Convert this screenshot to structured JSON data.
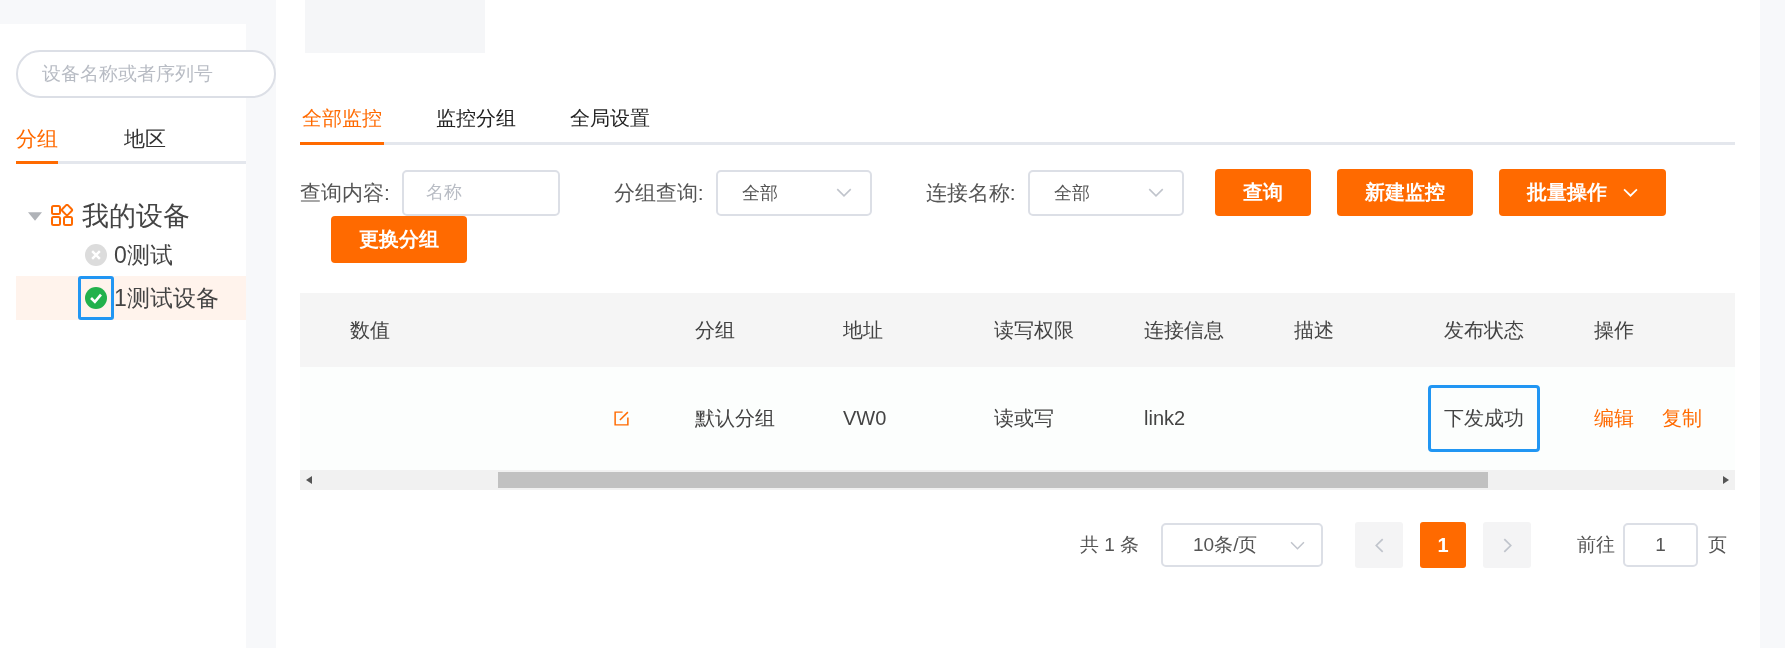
{
  "sidebar": {
    "search": {
      "placeholder": "设备名称或者序列号"
    },
    "tabs": [
      {
        "label": "分组",
        "selected": true
      },
      {
        "label": "地区",
        "selected": false
      }
    ],
    "tree": [
      {
        "label": "我的设备",
        "expanded": true,
        "children": [
          {
            "label": "0测试",
            "online": false,
            "selected": false,
            "highlighted": false
          },
          {
            "label": "1测试设备",
            "online": true,
            "selected": true,
            "highlighted": true
          }
        ]
      }
    ]
  },
  "top_card": {
    "kind": "card"
  },
  "tabs": [
    {
      "label": "全部监控",
      "selected": true
    },
    {
      "label": "监控分组",
      "selected": false
    },
    {
      "label": "全局设置",
      "selected": false
    }
  ],
  "filters": [
    {
      "kind": "input",
      "label": "查询内容:",
      "placeholder": "名称"
    },
    {
      "kind": "select",
      "label": "分组查询:",
      "value": "全部"
    },
    {
      "kind": "select",
      "label": "连接名称:",
      "value": "全部"
    }
  ],
  "buttons": [
    {
      "label": "查询",
      "dropdown": false
    },
    {
      "label": "新建监控",
      "dropdown": false
    },
    {
      "label": "批量操作",
      "dropdown": true
    },
    {
      "label": "更换分组",
      "dropdown": false
    }
  ],
  "table": {
    "columns": [
      "数值",
      "",
      "分组",
      "地址",
      "读写权限",
      "连接信息",
      "描述",
      "发布状态",
      "操作"
    ],
    "rows": [
      {
        "value": "",
        "group": "默认分组",
        "address": "VW0",
        "access": "读或写",
        "connection": "link2",
        "description": "",
        "status": "下发成功",
        "status_highlighted": true,
        "actions": [
          "编辑",
          "复制"
        ]
      }
    ]
  },
  "pagination": {
    "total": "共 1 条",
    "page_size": "10条/页",
    "pages": [
      {
        "label": "1",
        "selected": true
      }
    ],
    "goto_label": "前往",
    "goto_value": "1",
    "page_suffix": "页"
  }
}
